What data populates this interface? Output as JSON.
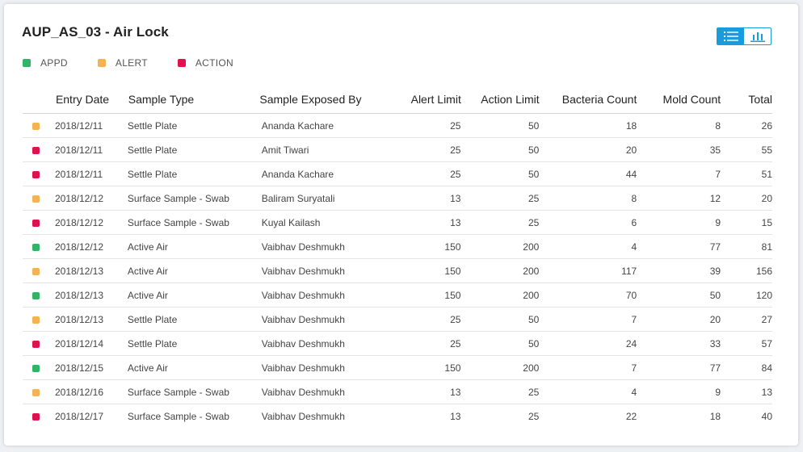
{
  "title": "AUP_AS_03 - Air Lock",
  "view_toggle": {
    "list_icon": "list-icon",
    "chart_icon": "bar-chart-icon",
    "active": "list"
  },
  "colors": {
    "APPD": "#2fb566",
    "ALERT": "#f4b350",
    "ACTION": "#e0114f",
    "accent": "#1a9bdc"
  },
  "legend": [
    {
      "key": "APPD",
      "label": "APPD"
    },
    {
      "key": "ALERT",
      "label": "ALERT"
    },
    {
      "key": "ACTION",
      "label": "ACTION"
    }
  ],
  "columns": [
    "Entry Date",
    "Sample Type",
    "Sample Exposed By",
    "Alert Limit",
    "Action Limit",
    "Bacteria Count",
    "Mold Count",
    "Total"
  ],
  "rows": [
    {
      "status": "ALERT",
      "date": "2018/12/11",
      "type": "Settle Plate",
      "by": "Ananda Kachare",
      "alert": "25",
      "action": "50",
      "bacteria": "18",
      "mold": "8",
      "total": "26"
    },
    {
      "status": "ACTION",
      "date": "2018/12/11",
      "type": "Settle Plate",
      "by": "Amit Tiwari",
      "alert": "25",
      "action": "50",
      "bacteria": "20",
      "mold": "35",
      "total": "55"
    },
    {
      "status": "ACTION",
      "date": "2018/12/11",
      "type": "Settle Plate",
      "by": "Ananda Kachare",
      "alert": "25",
      "action": "50",
      "bacteria": "44",
      "mold": "7",
      "total": "51"
    },
    {
      "status": "ALERT",
      "date": "2018/12/12",
      "type": "Surface Sample - Swab",
      "by": "Baliram Suryatali",
      "alert": "13",
      "action": "25",
      "bacteria": "8",
      "mold": "12",
      "total": "20"
    },
    {
      "status": "ACTION",
      "date": "2018/12/12",
      "type": "Surface Sample - Swab",
      "by": "Kuyal Kailash",
      "alert": "13",
      "action": "25",
      "bacteria": "6",
      "mold": "9",
      "total": "15"
    },
    {
      "status": "APPD",
      "date": "2018/12/12",
      "type": "Active Air",
      "by": "Vaibhav Deshmukh",
      "alert": "150",
      "action": "200",
      "bacteria": "4",
      "mold": "77",
      "total": "81"
    },
    {
      "status": "ALERT",
      "date": "2018/12/13",
      "type": "Active Air",
      "by": "Vaibhav Deshmukh",
      "alert": "150",
      "action": "200",
      "bacteria": "117",
      "mold": "39",
      "total": "156"
    },
    {
      "status": "APPD",
      "date": "2018/12/13",
      "type": "Active Air",
      "by": "Vaibhav Deshmukh",
      "alert": "150",
      "action": "200",
      "bacteria": "70",
      "mold": "50",
      "total": "120"
    },
    {
      "status": "ALERT",
      "date": "2018/12/13",
      "type": "Settle Plate",
      "by": "Vaibhav Deshmukh",
      "alert": "25",
      "action": "50",
      "bacteria": "7",
      "mold": "20",
      "total": "27"
    },
    {
      "status": "ACTION",
      "date": "2018/12/14",
      "type": "Settle Plate",
      "by": "Vaibhav Deshmukh",
      "alert": "25",
      "action": "50",
      "bacteria": "24",
      "mold": "33",
      "total": "57"
    },
    {
      "status": "APPD",
      "date": "2018/12/15",
      "type": "Active Air",
      "by": "Vaibhav Deshmukh",
      "alert": "150",
      "action": "200",
      "bacteria": "7",
      "mold": "77",
      "total": "84"
    },
    {
      "status": "ALERT",
      "date": "2018/12/16",
      "type": "Surface Sample - Swab",
      "by": "Vaibhav Deshmukh",
      "alert": "13",
      "action": "25",
      "bacteria": "4",
      "mold": "9",
      "total": "13"
    },
    {
      "status": "ACTION",
      "date": "2018/12/17",
      "type": "Surface Sample - Swab",
      "by": "Vaibhav Deshmukh",
      "alert": "13",
      "action": "25",
      "bacteria": "22",
      "mold": "18",
      "total": "40"
    }
  ]
}
